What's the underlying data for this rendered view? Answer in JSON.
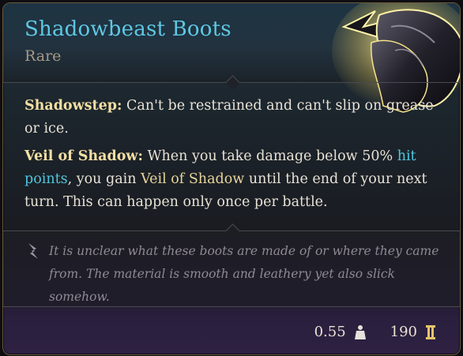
{
  "item": {
    "name": "Shadowbeast Boots",
    "rarity": "Rare"
  },
  "passives": {
    "shadowstep_label": "Shadowstep:",
    "shadowstep_text": "Can't be restrained and can't slip on grease or ice.",
    "veil_label": "Veil of Shadow:",
    "veil_text_1": "When you take damage below 50%",
    "veil_link": "hit points",
    "veil_text_2": ", you gain",
    "veil_condition": "Veil of Shadow",
    "veil_text_3": "until the end of your next turn. This can happen only once per battle."
  },
  "lore": {
    "text": "It is unclear what these boots are made of or where they came from. The material is smooth and leathery yet also slick somehow."
  },
  "footer": {
    "weight": "0.55",
    "value": "190",
    "weight_icon": "weight-icon",
    "value_icon": "gold-coin-icon"
  },
  "colors": {
    "title": "#5ec8e4",
    "rarity": "#a59a88",
    "keyword": "#f3dfa3",
    "link": "#4fc7de",
    "lore": "#8f8a94"
  }
}
